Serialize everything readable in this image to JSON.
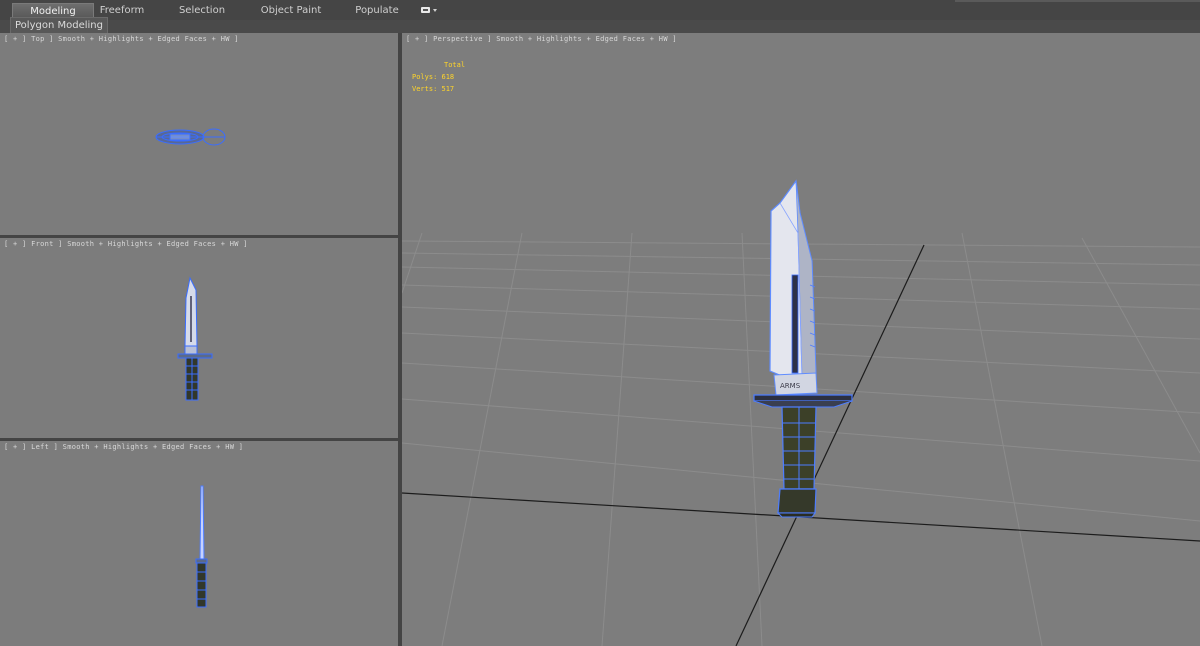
{
  "ribbon": {
    "tabs": [
      {
        "label": "Modeling",
        "active": true
      },
      {
        "label": "Freeform",
        "active": false
      },
      {
        "label": "Selection",
        "active": false
      },
      {
        "label": "Object Paint",
        "active": false
      },
      {
        "label": "Populate",
        "active": false
      }
    ],
    "dropdown_icon": "panel-options-icon",
    "sub_label": "Polygon Modeling"
  },
  "viewports": {
    "top": {
      "label": "[ + ] Top ] Smooth + Highlights + Edged Faces + HW ]"
    },
    "front": {
      "label": "[ + ] Front ] Smooth + Highlights + Edged Faces + HW ]"
    },
    "left": {
      "label": "[ + ] Left ] Smooth + Highlights + Edged Faces + HW ]"
    },
    "perspective": {
      "label": "[ + ] Perspective ] Smooth + Highlights + Edged Faces + HW ]",
      "stats": {
        "header": "Total",
        "polys": "Polys: 618",
        "verts": "Verts: 517"
      }
    }
  },
  "colors": {
    "viewport_bg": "#7c7c7c",
    "wire_blue": "#4d7dff",
    "stats_yellow": "#ffd52a",
    "label_text": "#d8d8d8"
  },
  "model": {
    "name": "knife",
    "blade_emblem": "ARMS"
  }
}
